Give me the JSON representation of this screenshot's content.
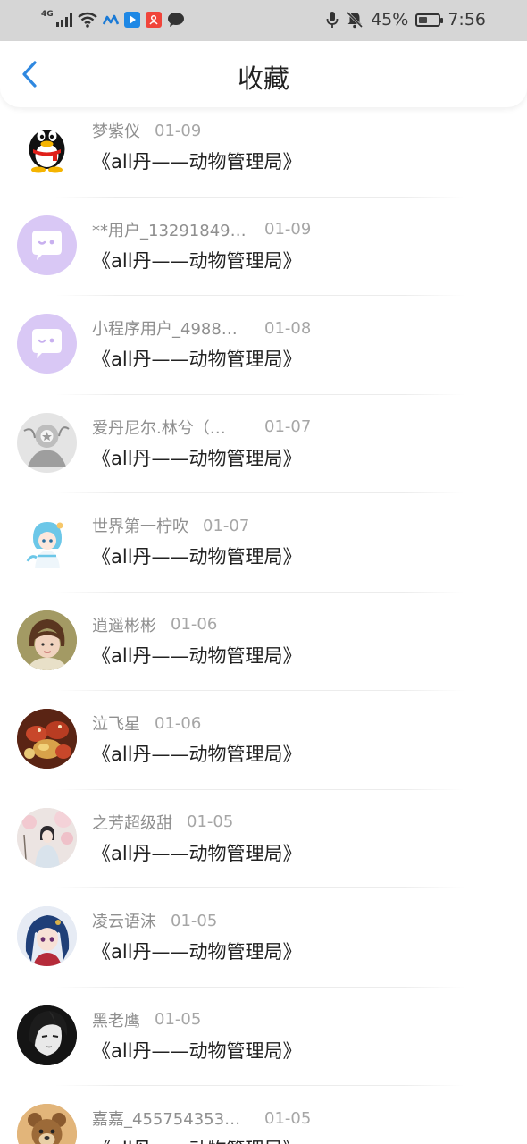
{
  "status_bar": {
    "network": "4G",
    "battery": "45%",
    "battery_level": 0.45,
    "time": "7:56",
    "left_icons": [
      "signal-icon",
      "wifi-icon",
      "app-icon",
      "app-icon",
      "app-icon",
      "chat-bubble-icon"
    ],
    "right_icons": [
      "microphone-icon",
      "mute-bell-icon",
      "battery-icon"
    ]
  },
  "header": {
    "title": "收藏",
    "back_icon": "chevron-left-icon",
    "accent": "#2f88e0"
  },
  "items": [
    {
      "name": "梦紫仪",
      "date": "01-09",
      "title": "《all丹——动物管理局》",
      "avatar": "qq-penguin"
    },
    {
      "name": "**用户_13291849…",
      "date": "01-09",
      "title": "《all丹——动物管理局》",
      "avatar": "default-purple"
    },
    {
      "name": "小程序用户_4988…",
      "date": "01-08",
      "title": "《all丹——动物管理局》",
      "avatar": "default-purple"
    },
    {
      "name": "爱丹尼尔.林兮（…",
      "date": "01-07",
      "title": "《all丹——动物管理局》",
      "avatar": "grey-illustration"
    },
    {
      "name": "世界第一柠吹",
      "date": "01-07",
      "title": "《all丹——动物管理局》",
      "avatar": "anime-blue"
    },
    {
      "name": "逍遥彬彬",
      "date": "01-06",
      "title": "《all丹——动物管理局》",
      "avatar": "photo-girl"
    },
    {
      "name": "泣飞星",
      "date": "01-06",
      "title": "《all丹——动物管理局》",
      "avatar": "food-photo"
    },
    {
      "name": "之芳超级甜",
      "date": "01-05",
      "title": "《all丹——动物管理局》",
      "avatar": "blossom-photo"
    },
    {
      "name": "凌云语沫",
      "date": "01-05",
      "title": "《all丹——动物管理局》",
      "avatar": "anime-dark-blue"
    },
    {
      "name": "黑老鹰",
      "date": "01-05",
      "title": "《all丹——动物管理局》",
      "avatar": "monochrome-portrait"
    },
    {
      "name": "嘉嘉_455754353…",
      "date": "01-05",
      "title": "《all丹——动物管理局》",
      "avatar": "cartoon-bear"
    }
  ]
}
